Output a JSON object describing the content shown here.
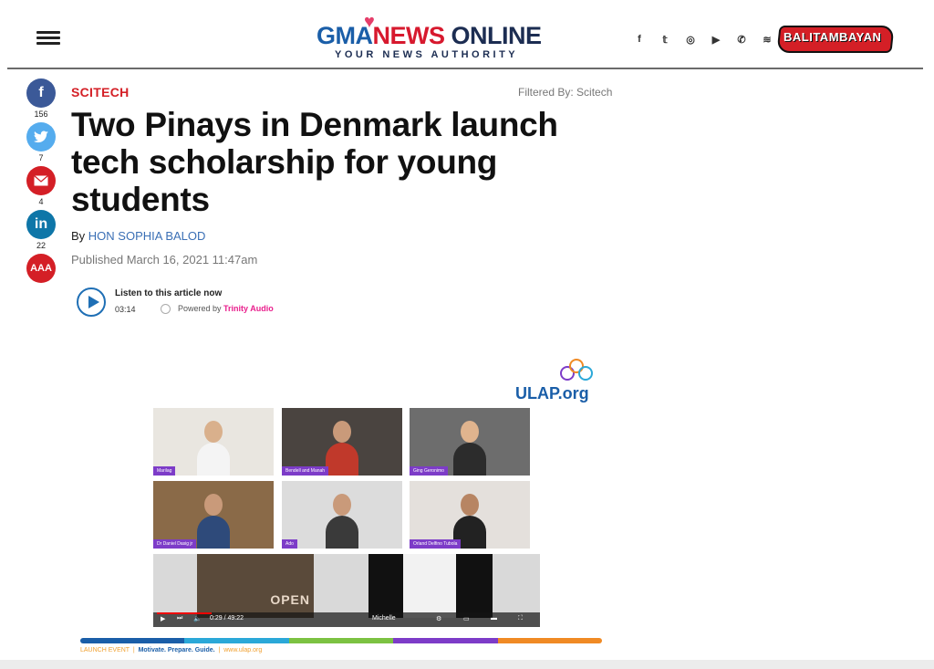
{
  "header": {
    "logo_gma": "GMA",
    "logo_news": "NEWS",
    "logo_online": "ONLINE",
    "logo_tagline": "YOUR NEWS AUTHORITY",
    "social_icons": [
      {
        "name": "facebook-icon",
        "glyph": "f"
      },
      {
        "name": "twitter-icon",
        "glyph": "𝕥"
      },
      {
        "name": "instagram-icon",
        "glyph": "◎"
      },
      {
        "name": "youtube-icon",
        "glyph": "▶"
      },
      {
        "name": "phone-icon",
        "glyph": "✆"
      },
      {
        "name": "rss-icon",
        "glyph": "≋"
      }
    ],
    "brand_right": "BALITAMBAYAN"
  },
  "share": {
    "facebook_count": "156",
    "twitter_count": "7",
    "email_count": "4",
    "linkedin_count": "22",
    "font_size_label": "AAA"
  },
  "article": {
    "section": "SCITECH",
    "filtered_by": "Filtered By: Scitech",
    "title": "Two Pinays in Denmark launch tech scholarship for young students",
    "by_prefix": "By ",
    "author": "HON SOPHIA BALOD",
    "published": "Published March 16, 2021 11:47am"
  },
  "audio": {
    "listen_label": "Listen to this article now",
    "duration": "03:14",
    "powered_prefix": "Powered by ",
    "powered_brand": "Trinity Audio"
  },
  "hero": {
    "ulap_logo": "ULAP.org",
    "participants": [
      "Marilag",
      "Bendell and Manah",
      "Ging Geronimo",
      "Dr Daniel Dasig jr",
      "Ado",
      "Orland Delfino Tubola"
    ],
    "open_sign": "OPEN",
    "video_time": "0:29 / 49:22",
    "bottom_participant": "Michelle",
    "footer_event": "LAUNCH EVENT",
    "footer_tagline": "Motivate. Prepare. Guide.",
    "footer_url": "www.ulap.org"
  },
  "colors": {
    "accent_red": "#d41f26",
    "link_blue": "#3a6fb5",
    "facebook": "#3b5998",
    "twitter": "#55acee",
    "linkedin": "#0e76a8"
  }
}
